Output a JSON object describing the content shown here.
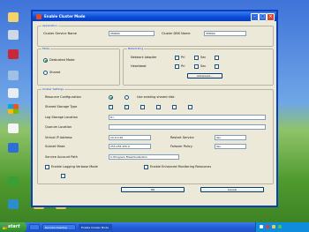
{
  "window": {
    "title": "Enable Cluster Mode"
  },
  "start_label": "start",
  "taskbar": {
    "tasks": [
      "",
      "Remote Desktop",
      "Enable Cluster Mode"
    ],
    "clock": ""
  },
  "section_top": {
    "title": "Application",
    "name_label": "Cluster Service Name",
    "name_value": "VMDKS",
    "dns_label": "Cluster DNS Name",
    "dns_value": "VMDKS"
  },
  "section_mode": {
    "title": "Mode",
    "options": [
      "Dedicated Mode",
      "Shared"
    ]
  },
  "section_network": {
    "title": "Networking",
    "rows": [
      "Network Adapter",
      "Heartbeat"
    ],
    "check_labels": [
      "Pri",
      "Sec"
    ],
    "button": "Advanced..."
  },
  "section_settings": {
    "title": "Cluster Settings",
    "rows": [
      {
        "label": "Resource Configuration",
        "value": "Use existing shared disk"
      },
      {
        "label": "Shared Storage Type",
        "value": ""
      },
      {
        "label": "Log Storage Location",
        "value": "D:\\"
      },
      {
        "label": "Quorum Location",
        "value": ""
      },
      {
        "label": "Virtual IP Address",
        "value": "10.0.0.50"
      },
      {
        "label": "Subnet Mask",
        "value": "255.255.255.0"
      },
      {
        "label": "Service Account Path",
        "value": "C:\\Program Files\\Cluster\\bin"
      }
    ],
    "extra_labels": [
      "Restart Service",
      "Failover Policy"
    ],
    "extra_values": [
      "Yes",
      "Yes"
    ],
    "bottom_check1": "Enable Logging Verbose Mode",
    "bottom_check2": "Enable Enhanced Monitoring Resources"
  },
  "buttons": {
    "ok": "OK",
    "cancel": "Cancel"
  }
}
